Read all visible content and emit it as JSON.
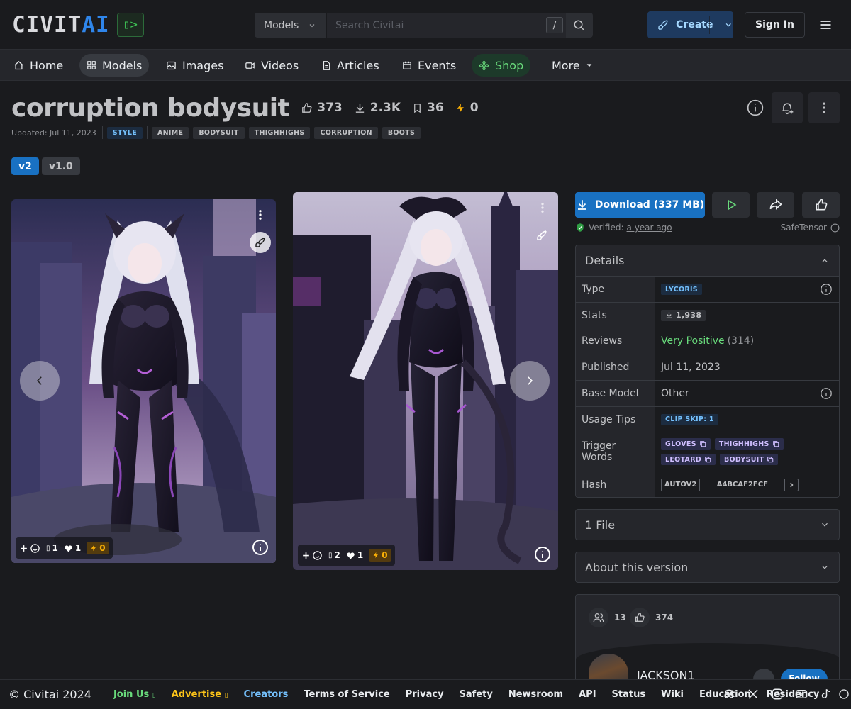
{
  "header": {
    "logo_text_main": "CIVIT",
    "logo_text_accent": "AI",
    "logo_badge": "▯>",
    "search_scope": "Models",
    "search_placeholder": "Search Civitai",
    "search_shortcut": "/",
    "create_label": "Create",
    "signin_label": "Sign In"
  },
  "nav": {
    "items": [
      {
        "label": "Home",
        "icon": "home-icon"
      },
      {
        "label": "Models",
        "icon": "grid-icon"
      },
      {
        "label": "Images",
        "icon": "photo-icon"
      },
      {
        "label": "Videos",
        "icon": "video-icon"
      },
      {
        "label": "Articles",
        "icon": "article-icon"
      },
      {
        "label": "Events",
        "icon": "calendar-icon"
      },
      {
        "label": "Shop",
        "icon": "shop-icon"
      },
      {
        "label": "More",
        "icon": "caret-down-icon"
      }
    ]
  },
  "model": {
    "title": "corruption bodysuit",
    "likes": "373",
    "downloads": "2.3K",
    "bookmarks": "36",
    "buzz": "0",
    "updated": "Updated: Jul 11, 2023",
    "category_tag": "STYLE",
    "tags": [
      "ANIME",
      "BODYSUIT",
      "THIGHHIGHS",
      "CORRUPTION",
      "BOOTS"
    ],
    "versions": [
      "v2",
      "v1.0"
    ]
  },
  "gallery": [
    {
      "comments": "1",
      "hearts": "1",
      "buzz": "0"
    },
    {
      "comments": "2",
      "hearts": "1",
      "buzz": "0"
    }
  ],
  "actions": {
    "download_label": "Download (337 MB)",
    "verified_label": "Verified:",
    "verified_time": "a year ago",
    "format_label": "SafeTensor"
  },
  "details": {
    "heading": "Details",
    "rows": {
      "type_key": "Type",
      "type_val": "LYCORIS",
      "stats_key": "Stats",
      "stats_val": "1,938",
      "reviews_key": "Reviews",
      "reviews_val": "Very Positive",
      "reviews_count": "(314)",
      "published_key": "Published",
      "published_val": "Jul 11, 2023",
      "base_key": "Base Model",
      "base_val": "Other",
      "usage_key": "Usage Tips",
      "usage_val": "CLIP SKIP: 1",
      "trigger_key": "Trigger Words",
      "triggers": [
        "GLOVES",
        "THIGHHIGHS",
        "LEOTARD",
        "BODYSUIT"
      ],
      "hash_key": "Hash",
      "hash_type": "AUTOV2",
      "hash_val": "A4BCAF2FCF"
    }
  },
  "accordions": {
    "files": "1 File",
    "about": "About this version"
  },
  "creator": {
    "followers": "13",
    "likes": "374",
    "username": "JACKSON1",
    "follow_label": "Follow"
  },
  "footer": {
    "copyright": "© Civitai 2024",
    "links": [
      "Join Us",
      "Advertise",
      "Creators",
      "Terms of Service",
      "Privacy",
      "Safety",
      "Newsroom",
      "API",
      "Status",
      "Wiki",
      "Education",
      "Residency"
    ]
  },
  "colors": {
    "background": "#1a1b1e",
    "accent_blue": "#1971c2",
    "success_green": "#69db7c"
  }
}
